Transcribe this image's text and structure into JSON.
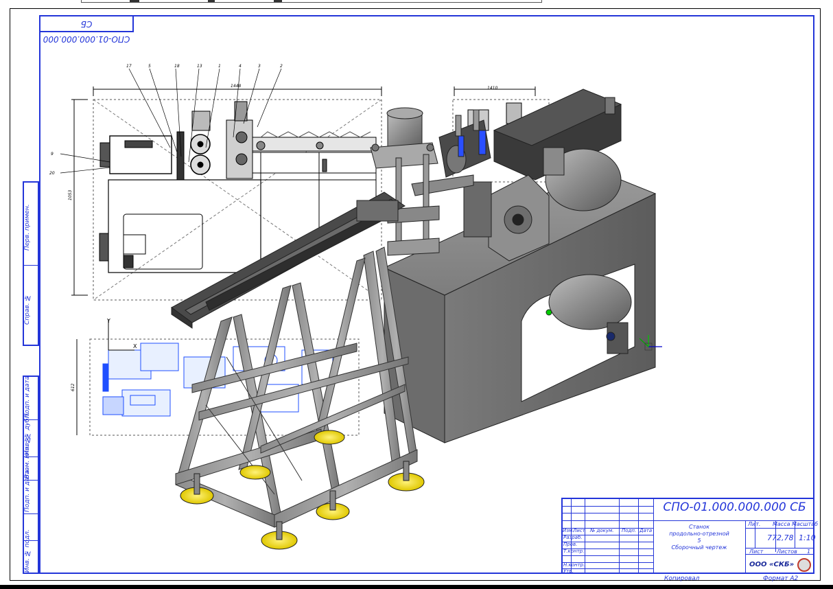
{
  "sheet": {
    "rotated_code": "СПО-01.000.000.000 СБ",
    "left_column_labels": [
      "Перв. примен.",
      "Справ. №",
      "Подп. и дата",
      "Инв. № дубл.",
      "Взам. инв. №",
      "Подп. и дата",
      "Инв. № подл."
    ]
  },
  "drawing": {
    "top_dim_1": "1448",
    "top_dim_2": "1410",
    "left_dim": "1053",
    "bottom_left_dim": "612",
    "callout_labels": [
      "17",
      "5",
      "18",
      "13",
      "1",
      "4",
      "3",
      "2",
      "9",
      "20"
    ],
    "axis_y": "Y",
    "axis_x": "X"
  },
  "title_block": {
    "designation": "СПО-01.000.000.000 СБ",
    "name_lines": [
      "Станок",
      "продольно-отрезной",
      "5",
      "Сборочный чертеж"
    ],
    "mass": "772,78",
    "scale": "1:10",
    "headers": {
      "lit": "Лит.",
      "mass": "Масса",
      "scale": "Масштаб"
    },
    "sheet_label": "Лист",
    "sheets_label": "Листов",
    "sheets_value": "1",
    "row_labels": [
      "Изм.",
      "Лист",
      "№ докум.",
      "Подп.",
      "Дата"
    ],
    "roles": [
      "Разраб.",
      "Пров.",
      "Т.контр.",
      "",
      "Н.контр.",
      "Утв."
    ],
    "company": "ООО «СКБ»"
  },
  "footer": {
    "copied": "Копировал",
    "format": "Формат A2"
  }
}
